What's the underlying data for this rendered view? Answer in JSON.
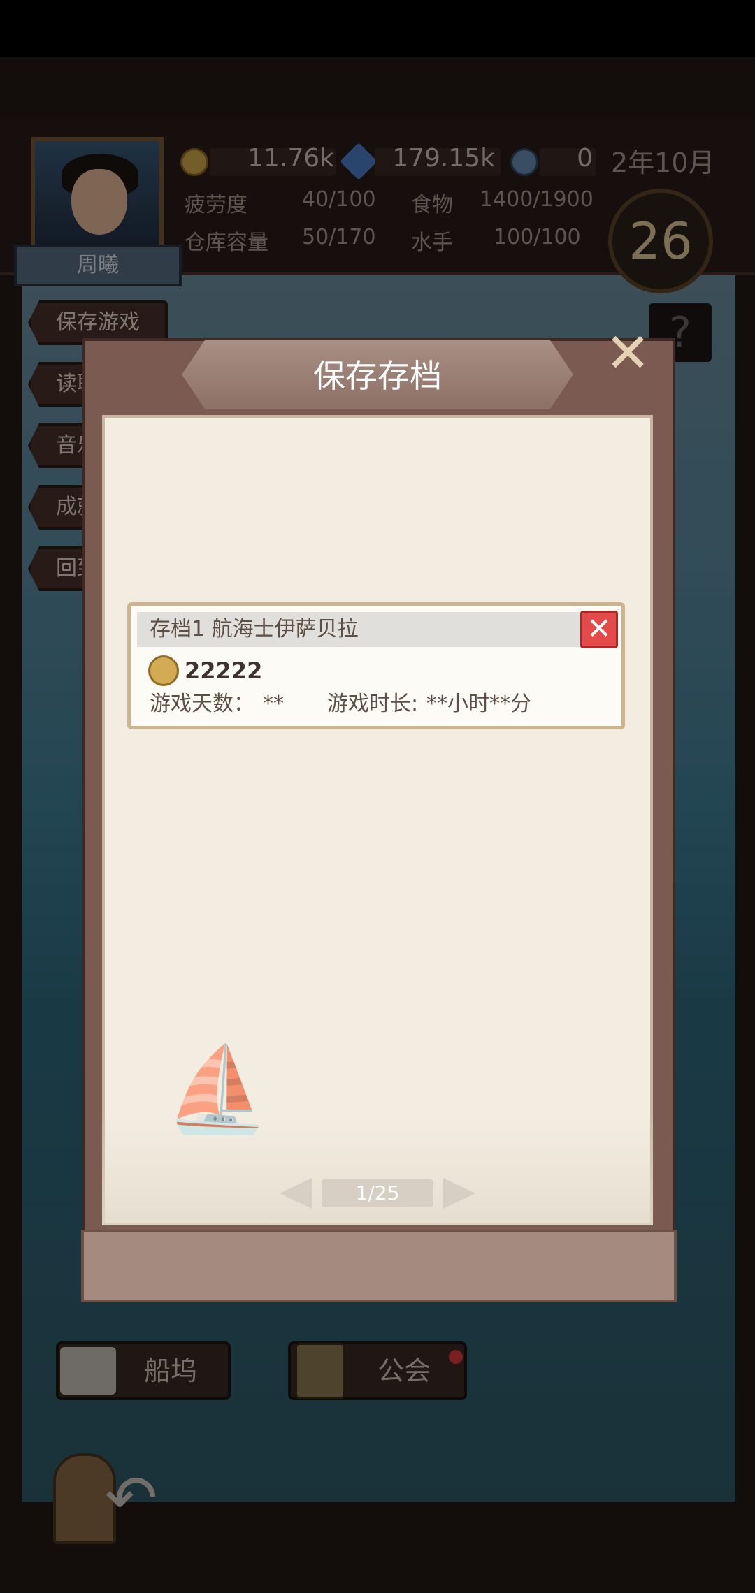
{
  "player": {
    "name": "周曦"
  },
  "resources": {
    "gold": "11.76k",
    "gems": "179.15k",
    "medals": "0"
  },
  "date": "2年10月",
  "stats": {
    "fatigue_label": "疲劳度",
    "fatigue_value": "40/100",
    "food_label": "食物",
    "food_value": "1400/1900",
    "warehouse_label": "仓库容量",
    "warehouse_value": "50/170",
    "sailors_label": "水手",
    "sailors_value": "100/100"
  },
  "day_counter": "26",
  "help_label": "?",
  "side_menu": [
    {
      "label": "保存游戏"
    },
    {
      "label": "读取游戏"
    },
    {
      "label": "音乐"
    },
    {
      "label": "成就"
    },
    {
      "label": "回到"
    }
  ],
  "bottom_nav": {
    "dock_label": "船坞",
    "guild_label": "公会"
  },
  "modal": {
    "title": "保存存档",
    "close_label": "✕",
    "slot": {
      "title": "存档1   航海士伊萨贝拉",
      "gold": "22222",
      "days_label": "游戏天数：",
      "days_value": "**",
      "time_label": "游戏时长:",
      "time_value": "**小时**分",
      "delete_label": "✕"
    },
    "pager": {
      "current": "1/25"
    }
  },
  "colors": {
    "accent_red": "#e54a4a",
    "paper": "#f3ede1",
    "frame": "#7b5b51"
  }
}
